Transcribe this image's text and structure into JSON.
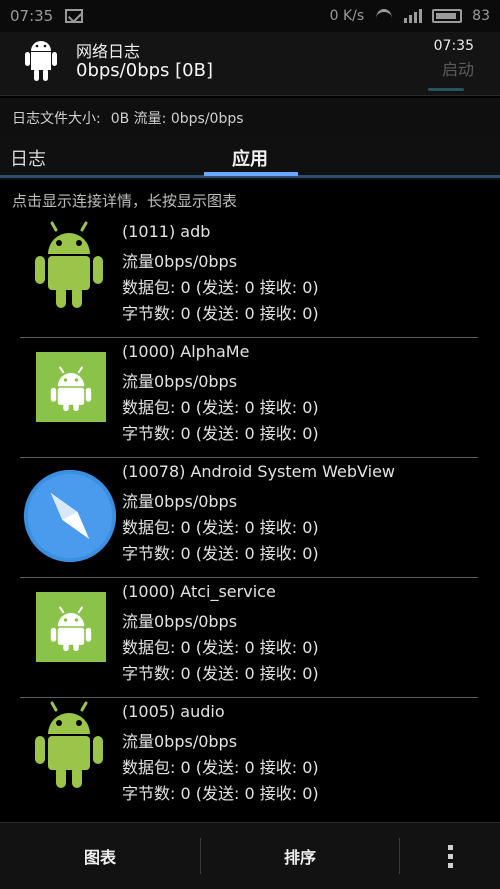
{
  "status_bar": {
    "time": "07:35",
    "net_speed": "0 K/s",
    "battery": "83",
    "icons": [
      "mailbox-icon",
      "wifi-icon",
      "signal-icon",
      "battery-icon"
    ]
  },
  "header": {
    "title": "网络日志",
    "subtitle": "0bps/0bps [0B]",
    "clock": "07:35",
    "start_label": "启动"
  },
  "info": {
    "log_file_label": "日志文件大小:",
    "summary": "0B 流量: 0bps/0bps"
  },
  "tabs": [
    {
      "label": "日志",
      "active": false
    },
    {
      "label": "应用",
      "active": true
    }
  ],
  "hint": "点击显示连接详情，长按显示图表",
  "apps": [
    {
      "name": "(1011) adb",
      "traffic": "流量0bps/0bps",
      "packets": "数据包:  0 (发送:  0 接收:  0)",
      "bytes": "字节数:  0 (发送:  0 接收:  0)",
      "icon": "android-robot-icon"
    },
    {
      "name": "(1000) AlphaMe",
      "traffic": "流量0bps/0bps",
      "packets": "数据包:  0 (发送:  0 接收:  0)",
      "bytes": "字节数:  0 (发送:  0 接收:  0)",
      "icon": "android-square-icon"
    },
    {
      "name": "(10078) Android System WebView",
      "traffic": "流量0bps/0bps",
      "packets": "数据包:  0 (发送:  0 接收:  0)",
      "bytes": "字节数:  0 (发送:  0 接收:  0)",
      "icon": "compass-icon"
    },
    {
      "name": "(1000) Atci_service",
      "traffic": "流量0bps/0bps",
      "packets": "数据包:  0 (发送:  0 接收:  0)",
      "bytes": "字节数:  0 (发送:  0 接收:  0)",
      "icon": "android-square-icon"
    },
    {
      "name": "(1005) audio",
      "traffic": "流量0bps/0bps",
      "packets": "数据包:  0 (发送:  0 接收:  0)",
      "bytes": "字节数:  0 (发送:  0 接收:  0)",
      "icon": "android-robot-icon"
    }
  ],
  "bottom_bar": {
    "chart_label": "图表",
    "sort_label": "排序",
    "more_icon": "overflow-menu-icon"
  },
  "colors": {
    "android_green": "#9bc44a",
    "tab_accent": "#6aa8ff",
    "webview_blue": "#3a8fe0"
  }
}
